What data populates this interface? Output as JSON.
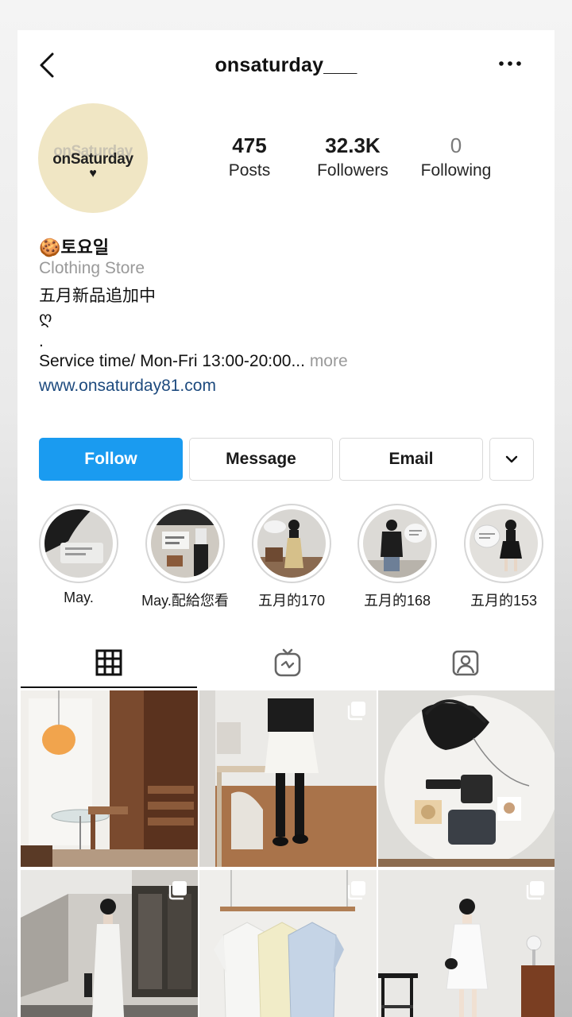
{
  "header": {
    "username": "onsaturday___"
  },
  "avatar": {
    "logo_text": "onSaturday",
    "logo_ghost_text": "onSaturday",
    "heart": "♥"
  },
  "stats": [
    {
      "value": "475",
      "label": "Posts"
    },
    {
      "value": "32.3K",
      "label": "Followers"
    },
    {
      "value": "0",
      "label": "Following"
    }
  ],
  "bio": {
    "name": "🍪토요일",
    "category": "Clothing Store",
    "line1": "五月新品追加中",
    "line2": "ღ",
    "line3": ".",
    "line4": "Service time/ Mon-Fri 13:00-20:00...",
    "more": "more",
    "website": "www.onsaturday81.com"
  },
  "actions": {
    "follow": "Follow",
    "message": "Message",
    "email": "Email",
    "dropdown_icon": "chevron-down-icon"
  },
  "highlights": [
    {
      "label": "May."
    },
    {
      "label": "May.配給您看"
    },
    {
      "label": "五月的170"
    },
    {
      "label": "五月的168"
    },
    {
      "label": "五月的153"
    }
  ],
  "tabs": [
    {
      "icon": "grid-icon",
      "active": true
    },
    {
      "icon": "igtv-icon",
      "active": false
    },
    {
      "icon": "tagged-icon",
      "active": false
    }
  ],
  "posts": [
    {
      "subject": "interior with paper lamp",
      "multi": false
    },
    {
      "subject": "outfit white skirt",
      "multi": true
    },
    {
      "subject": "black bag flatlay",
      "multi": false
    },
    {
      "subject": "white dress street",
      "multi": true
    },
    {
      "subject": "shirts on rack",
      "multi": true
    },
    {
      "subject": "white dress studio",
      "multi": true
    }
  ],
  "colors": {
    "accent": "#1a9bf0",
    "link": "#1d4a7e",
    "muted": "#9a9a9a",
    "avatar_bg": "#f0e6c4"
  }
}
